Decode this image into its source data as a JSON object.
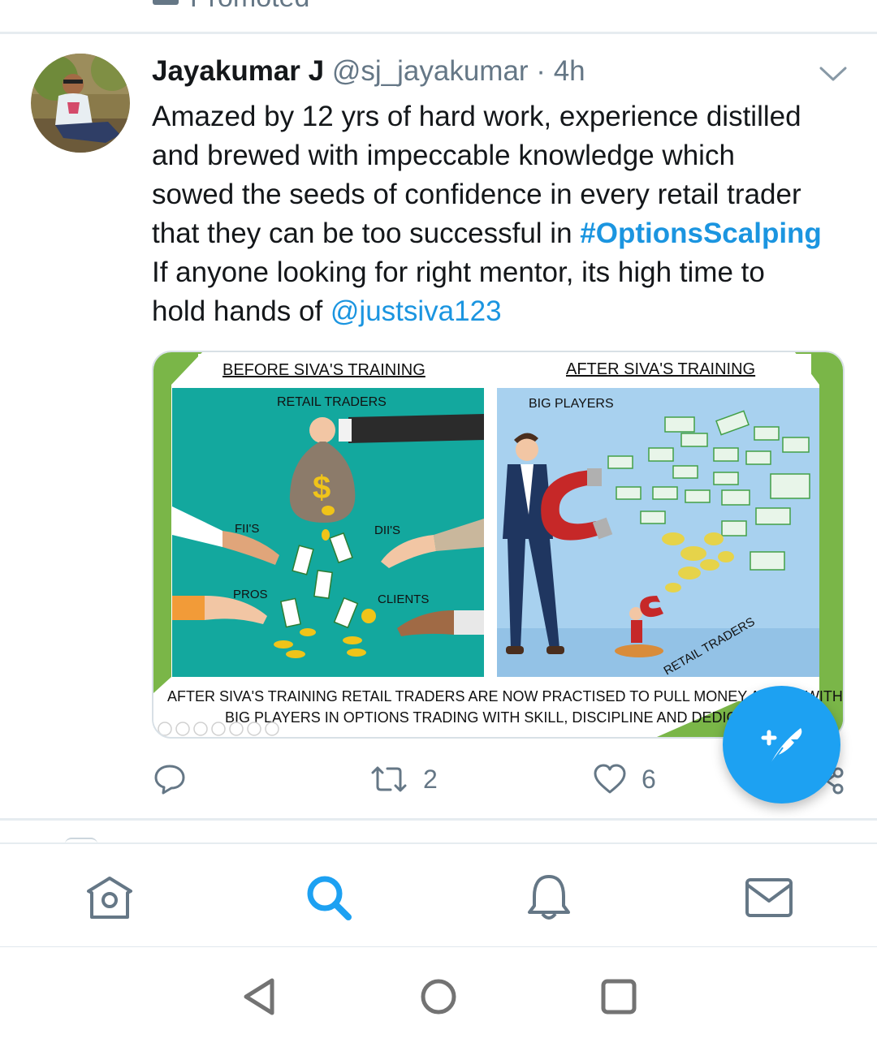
{
  "promoted": {
    "label": "Promoted"
  },
  "tweet": {
    "author_name": "Jayakumar J",
    "handle": "@sj_jayakumar",
    "separator": "·",
    "time": "4h",
    "text_lines": {
      "l1": "Amazed by 12 yrs of hard work, experience distilled",
      "l2": "and brewed with impeccable knowledge which",
      "l3": "sowed the seeds of confidence in every retail trader",
      "l4_prefix": "that they can be too successful in ",
      "l4_hashtag": "#OptionsScalping",
      "l5": "If anyone looking for right mentor, its high time to",
      "l6_prefix": "hold hands of ",
      "l6_mention": "@justsiva123"
    },
    "image": {
      "left_heading": "BEFORE SIVA'S TRAINING",
      "right_heading": "AFTER SIVA'S TRAINING",
      "left_panel_title": "RETAIL TRADERS",
      "right_panel_title": "BIG PLAYERS",
      "label_fii": "FII'S",
      "label_dii": "DII'S",
      "label_pros": "PROS",
      "label_clients": "CLIENTS",
      "label_retail_traders_diag": "RETAIL TRADERS",
      "caption_line1": "AFTER SIVA'S TRAINING RETAIL TRADERS ARE NOW PRACTISED TO PULL MONEY ALONG WITH",
      "caption_line2": "BIG PLAYERS IN OPTIONS TRADING WITH SKILL, DISCIPLINE AND DEDICATION"
    },
    "actions": {
      "reply_icon": "reply-icon",
      "retweet_icon": "retweet-icon",
      "retweet_count": "2",
      "like_icon": "heart-icon",
      "like_count": "6",
      "share_icon": "share-icon"
    }
  },
  "compose": {
    "icon": "compose-tweet-icon"
  },
  "tabbar": {
    "items": [
      {
        "icon": "home-icon",
        "active": false
      },
      {
        "icon": "search-icon",
        "active": true
      },
      {
        "icon": "bell-icon",
        "active": false
      },
      {
        "icon": "mail-icon",
        "active": false
      }
    ]
  },
  "system_nav": {
    "back": "back-triangle-icon",
    "home": "home-circle-icon",
    "recents": "recents-square-icon"
  },
  "colors": {
    "accent": "#1da1f2",
    "link": "#1b95e0",
    "muted": "#657786",
    "divider": "#e6ecf0"
  }
}
